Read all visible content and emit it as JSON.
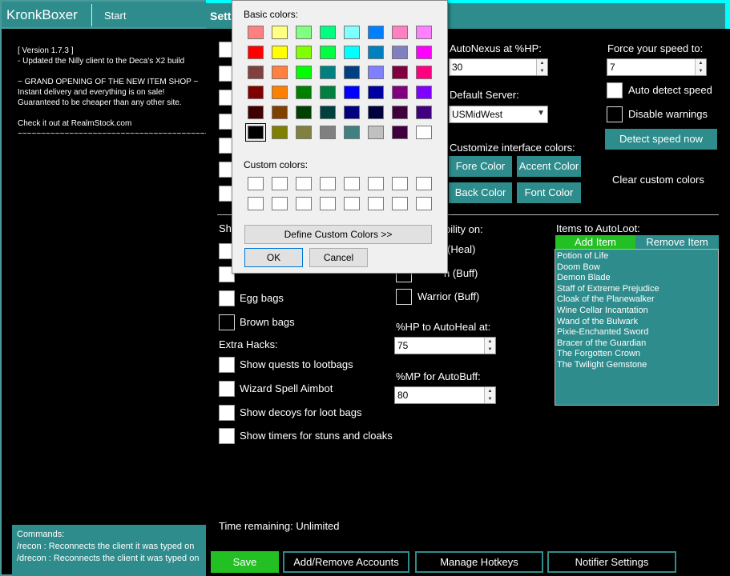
{
  "main_window": {
    "title": "KronkBoxer",
    "start_tab": "Start",
    "news": [
      "[ Version 1.7.3 ]",
      "- Updated the Nilly client to the Deca's X2 build",
      "",
      "~ GRAND OPENING OF THE NEW ITEM SHOP ~",
      "Instant delivery and everything is on sale!",
      "Guaranteed to be cheaper than any other site.",
      "",
      "Check it out at RealmStock.com",
      "~~~~~~~~~~~~~~~~~~~~~~~~~~~~~~~~~~~~~~~~~~~~~~"
    ],
    "commands": {
      "heading": "Commands:",
      "lines": [
        "/recon : Reconnects the client it was typed on",
        "/drecon : Reconnects the client it was typed on"
      ]
    }
  },
  "settings": {
    "title": "Sett",
    "autonexus_label": "AutoNexus at %HP:",
    "autonexus_value": "30",
    "default_server_label": "Default Server:",
    "default_server_value": "USMidWest",
    "force_speed_label": "Force your speed to:",
    "force_speed_value": "7",
    "auto_detect_speed": "Auto detect speed",
    "disable_warnings": "Disable warnings",
    "detect_speed_now": "Detect speed now",
    "customize_colors_label": "Customize interface colors:",
    "fore_color": "Fore Color",
    "accent_color": "Accent Color",
    "back_color": "Back Color",
    "font_color": "Font Color",
    "clear_custom_colors": "Clear custom colors",
    "show_label_partial": "Sh",
    "egg_bags": "Egg bags",
    "brown_bags": "Brown bags",
    "extra_hacks": "Extra Hacks:",
    "show_quests": "Show quests to lootbags",
    "wizard_aimbot": "Wizard Spell Aimbot",
    "show_decoys": "Show decoys for loot bags",
    "show_timers": "Show timers for stuns and cloaks",
    "ability_on_partial": "bility on:",
    "heal_partial": "(Heal)",
    "buff_partial": "n (Buff)",
    "warrior_buff": "Warrior (Buff)",
    "hp_autoheal_label": "%HP to AutoHeal at:",
    "hp_autoheal_value": "75",
    "mp_autobuff_label": "%MP for AutoBuff:",
    "mp_autobuff_value": "80",
    "items_autoloot_label": "Items to AutoLoot:",
    "add_item": "Add Item",
    "remove_item": "Remove Item",
    "loot_items": [
      "Potion of Life",
      "Doom Bow",
      "Demon Blade",
      "Staff of Extreme Prejudice",
      "Cloak of the Planewalker",
      "Wine Cellar Incantation",
      "Wand of the Bulwark",
      "Pixie-Enchanted Sword",
      "Bracer of the Guardian",
      "The Forgotten Crown",
      "The Twilight Gemstone"
    ],
    "time_remaining": "Time remaining: Unlimited",
    "bottom_buttons": {
      "save": "Save",
      "accounts": "Add/Remove Accounts",
      "hotkeys": "Manage Hotkeys",
      "notifier": "Notifier Settings"
    }
  },
  "color_dialog": {
    "basic_colors_label": "Basic colors:",
    "custom_colors_label": "Custom colors:",
    "define_custom": "Define Custom Colors >>",
    "ok": "OK",
    "cancel": "Cancel",
    "basic_colors": [
      [
        "#ff8080",
        "#ffff80",
        "#80ff80",
        "#00ff80",
        "#80ffff",
        "#0080ff",
        "#ff80c0",
        "#ff80ff"
      ],
      [
        "#ff0000",
        "#ffff00",
        "#80ff00",
        "#00ff40",
        "#00ffff",
        "#0080c0",
        "#8080c0",
        "#ff00ff"
      ],
      [
        "#804040",
        "#ff8040",
        "#00ff00",
        "#008080",
        "#004080",
        "#8080ff",
        "#800040",
        "#ff0080"
      ],
      [
        "#800000",
        "#ff8000",
        "#008000",
        "#008040",
        "#0000ff",
        "#0000a0",
        "#800080",
        "#8000ff"
      ],
      [
        "#400000",
        "#804000",
        "#004000",
        "#004040",
        "#000080",
        "#000040",
        "#400040",
        "#400080"
      ],
      [
        "#000000",
        "#808000",
        "#808040",
        "#808080",
        "#408080",
        "#c0c0c0",
        "#400040",
        "#ffffff"
      ]
    ],
    "selected_color": "#000000"
  }
}
